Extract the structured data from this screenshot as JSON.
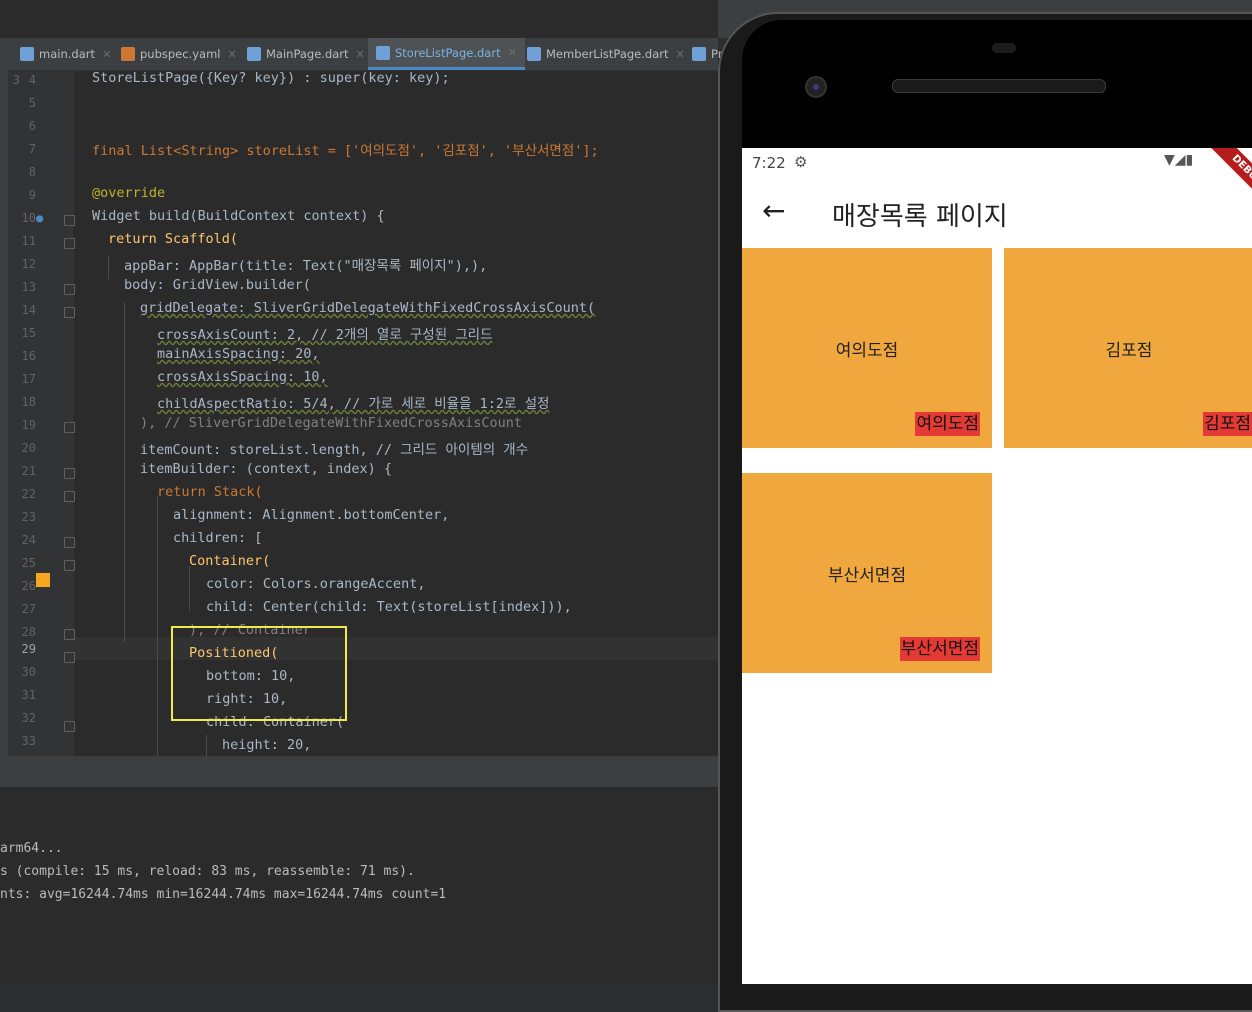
{
  "tabs": [
    {
      "label": "main.dart",
      "icon": "dart-file-icon"
    },
    {
      "label": "pubspec.yaml",
      "icon": "yaml-file-icon"
    },
    {
      "label": "MainPage.dart",
      "icon": "dart-file-icon"
    },
    {
      "label": "StoreListPage.dart",
      "icon": "dart-file-icon",
      "active": true
    },
    {
      "label": "MemberListPage.dart",
      "icon": "dart-file-icon"
    },
    {
      "label": "Pr",
      "icon": "dart-file-icon"
    }
  ],
  "line_numbers": [
    "4",
    "5",
    "6",
    "7",
    "8",
    "9",
    "10",
    "11",
    "12",
    "13",
    "14",
    "15",
    "16",
    "17",
    "18",
    "19",
    "20",
    "21",
    "22",
    "23",
    "24",
    "25",
    "26",
    "27",
    "28",
    "29",
    "30",
    "31",
    "32",
    "33"
  ],
  "gutter_extra_number": "3",
  "code": {
    "l4": "StoreListPage({Key? key}) : super(key: key);",
    "l7": "final List<String> storeList = ['여의도점', '김포점', '부산서면점'];",
    "l9": "@override",
    "l10": "Widget build(BuildContext context) {",
    "l11": "return Scaffold(",
    "l12": "appBar: AppBar(title: Text(\"매장목록 페이지\"),),",
    "l13": "body: GridView.builder(",
    "l14": "gridDelegate: SliverGridDelegateWithFixedCrossAxisCount(",
    "l15": "crossAxisCount: 2, // 2개의 열로 구성된 그리드",
    "l16": "mainAxisSpacing: 20,",
    "l17": "crossAxisSpacing: 10,",
    "l18": "childAspectRatio: 5/4, // 가로 세로 비율을 1:2로 설정",
    "l19": "), // SliverGridDelegateWithFixedCrossAxisCount",
    "l20": "itemCount: storeList.length, // 그리드 아이템의 개수",
    "l21": "itemBuilder: (context, index) {",
    "l22": "return Stack(",
    "l23": "alignment: Alignment.bottomCenter,",
    "l24": "children: [",
    "l25": "Container(",
    "l26": "color: Colors.orangeAccent,",
    "l27": "child: Center(child: Text(storeList[index])),",
    "l28": "), // Container",
    "l29": "Positioned(",
    "l30": "bottom: 10,",
    "l31": "right: 10,",
    "l32": "child: Container(",
    "l33": "height: 20,"
  },
  "console": [
    "arm64...",
    "s (compile: 15 ms, reload: 83 ms, reassemble: 71 ms).",
    "nts: avg=16244.74ms min=16244.74ms max=16244.74ms count=1"
  ],
  "phone": {
    "time": "7:22",
    "debug_banner": "DEBUG",
    "app_title": "매장목록 페이지",
    "stores": [
      "여의도점",
      "김포점",
      "부산서면점"
    ]
  },
  "colors": {
    "tile": "#f0a73d",
    "badge": "#e53935",
    "highlight_box": "#f2e94e"
  }
}
